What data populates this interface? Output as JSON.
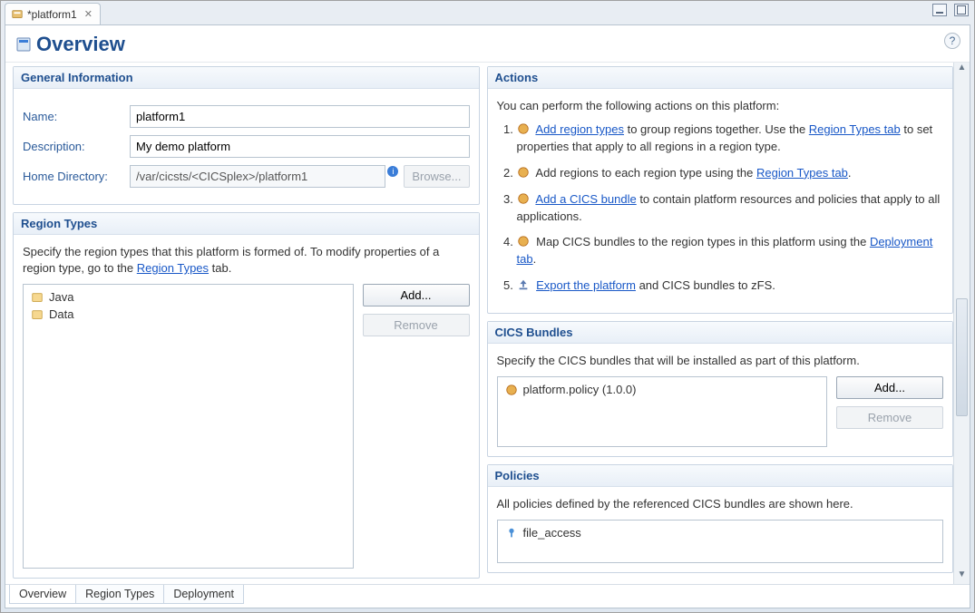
{
  "tab": {
    "title": "*platform1"
  },
  "page": {
    "title": "Overview",
    "help": "?"
  },
  "general": {
    "heading": "General Information",
    "name_label": "Name:",
    "name_value": "platform1",
    "desc_label": "Description:",
    "desc_value": "My demo platform",
    "home_label": "Home Directory:",
    "home_value": "/var/cicsts/<CICSplex>/platform1",
    "browse_btn": "Browse..."
  },
  "region_types": {
    "heading": "Region Types",
    "intro_a": "Specify the region types that this platform is formed of. To modify properties of a region type, go to the ",
    "intro_link": "Region Types",
    "intro_b": " tab.",
    "items": [
      "Java",
      "Data"
    ],
    "add_btn": "Add...",
    "remove_btn": "Remove"
  },
  "actions": {
    "heading": "Actions",
    "intro": "You can perform the following actions on this platform:",
    "items": [
      {
        "link1": "Add region types",
        "mid": " to group regions together. Use the ",
        "link2": "Region Types tab",
        "tail": " to set properties that apply to all regions in a region type."
      },
      {
        "pre": "Add regions to each region type using the ",
        "link1": "Region Types tab",
        "tail": "."
      },
      {
        "link1": "Add a CICS bundle",
        "tail": " to contain platform resources and policies that apply to all applications."
      },
      {
        "pre": "Map CICS bundles to the region types in this platform using the ",
        "link1": "Deployment tab",
        "tail": "."
      },
      {
        "link1": "Export the platform",
        "tail": " and CICS bundles to zFS."
      }
    ]
  },
  "bundles": {
    "heading": "CICS Bundles",
    "intro": "Specify the CICS bundles that will be installed as part of this platform.",
    "items": [
      "platform.policy (1.0.0)"
    ],
    "add_btn": "Add...",
    "remove_btn": "Remove"
  },
  "policies": {
    "heading": "Policies",
    "intro": "All policies defined by the referenced CICS bundles are shown here.",
    "items": [
      "file_access"
    ]
  },
  "bottom_tabs": {
    "overview": "Overview",
    "region_types": "Region Types",
    "deployment": "Deployment"
  }
}
